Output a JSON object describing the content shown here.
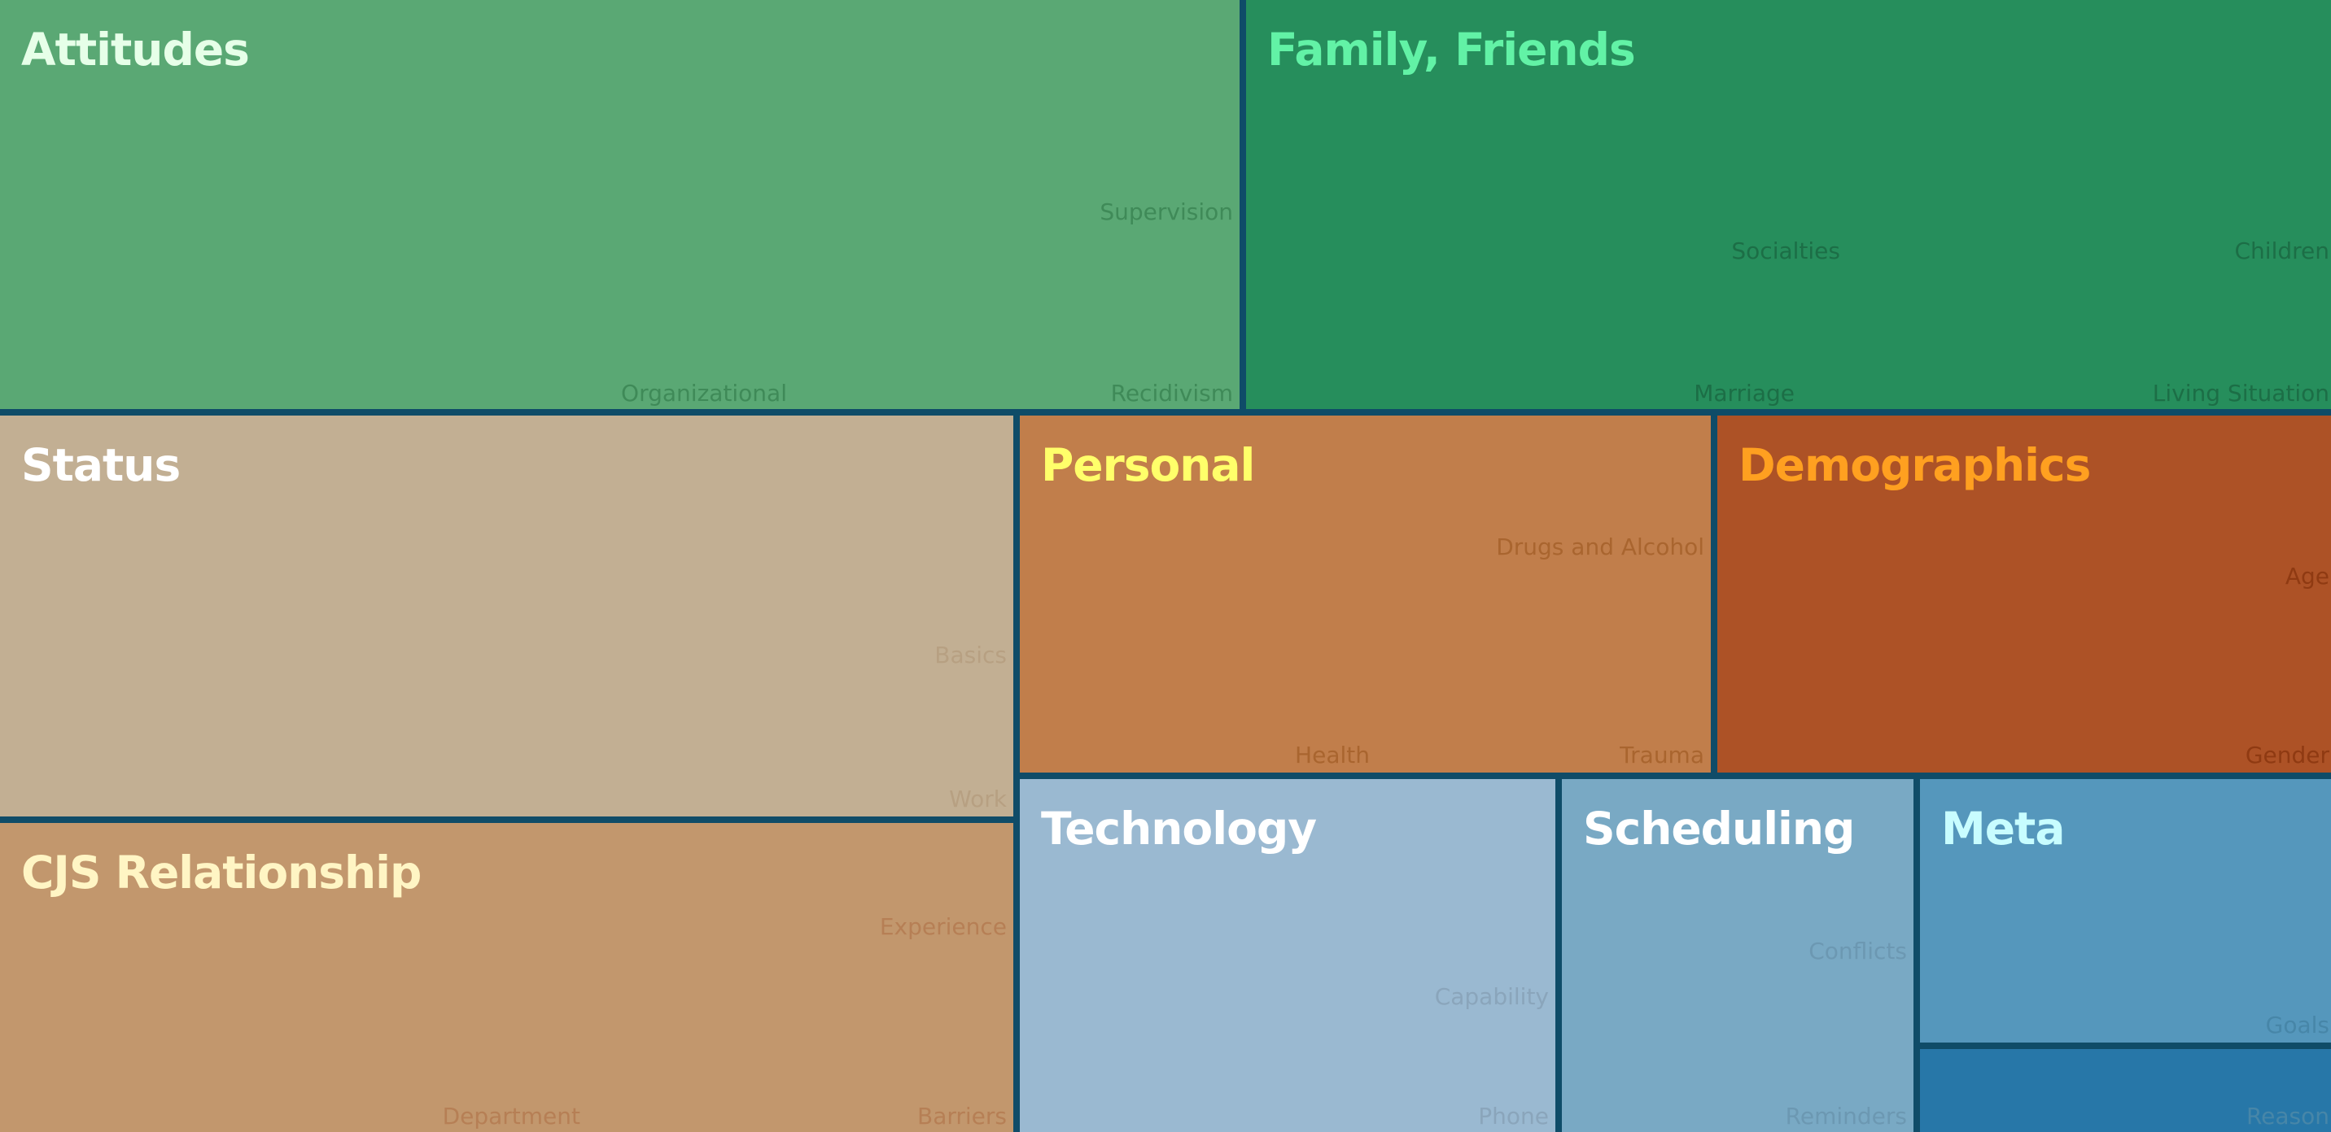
{
  "chart_data": {
    "type": "treemap",
    "title": "",
    "groups": [
      {
        "name": "Attitudes",
        "color": "#5aa874",
        "label_color": "#e6ffe8",
        "sub_color": "#3f8a58",
        "subcategories": [
          "Supervision",
          "Organizational",
          "Recidivism"
        ]
      },
      {
        "name": "Family, Friends",
        "color": "#268e5c",
        "label_color": "#62f2a6",
        "sub_color": "#1c6e46",
        "subcategories": [
          "Socialties",
          "Children",
          "Marriage",
          "Living Situation"
        ]
      },
      {
        "name": "Status",
        "color": "#c2af93",
        "label_color": "#ffffff",
        "sub_color": "#b7a082",
        "subcategories": [
          "Basics",
          "Work"
        ]
      },
      {
        "name": "CJS Relationship",
        "color": "#c2976d",
        "label_color": "#fff5c4",
        "sub_color": "#b67f55",
        "subcategories": [
          "Experience",
          "Department",
          "Barriers"
        ]
      },
      {
        "name": "Personal",
        "color": "#c17e4b",
        "label_color": "#ffff6a",
        "sub_color": "#a9652f",
        "subcategories": [
          "Drugs and Alcohol",
          "Health",
          "Trauma"
        ]
      },
      {
        "name": "Demographics",
        "color": "#ad5226",
        "label_color": "#ffa020",
        "sub_color": "#8f3a12",
        "subcategories": [
          "Age",
          "Gender"
        ]
      },
      {
        "name": "Technology",
        "color": "#9ab9d1",
        "label_color": "#ffffff",
        "sub_color": "#8aa5bb",
        "subcategories": [
          "Capability",
          "Phone"
        ]
      },
      {
        "name": "Scheduling",
        "color": "#79a9c4",
        "label_color": "#ffffff",
        "sub_color": "#6c98b2",
        "subcategories": [
          "Conflicts",
          "Reminders"
        ]
      },
      {
        "name": "Meta",
        "color": "#5597bc",
        "label_color": "#c8fdff",
        "sub_color": "#4786a8",
        "subcategories": [
          "Goals",
          "Reason"
        ]
      }
    ],
    "extra_regions": [
      {
        "parent": "Meta",
        "color": "#2777a8"
      }
    ]
  }
}
